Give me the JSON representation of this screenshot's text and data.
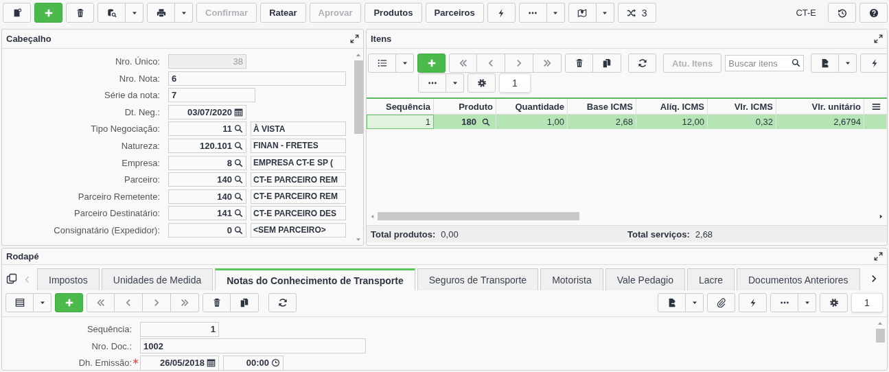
{
  "toolbar": {
    "buttons": [
      {
        "label": "Confirmar",
        "disabled": true
      },
      {
        "label": "Ratear",
        "disabled": false
      },
      {
        "label": "Aprovar",
        "disabled": true
      },
      {
        "label": "Produtos",
        "disabled": false
      },
      {
        "label": "Parceiros",
        "disabled": false
      }
    ],
    "variations_count": "3",
    "context_label": "CT-E"
  },
  "header_panel": {
    "title": "Cabeçalho",
    "fields": [
      {
        "label": "Nro. Único:",
        "kind": "number",
        "value": "38",
        "disabled": true
      },
      {
        "label": "Nro. Nota:",
        "kind": "text",
        "value": "6",
        "disabled": false
      },
      {
        "label": "Série da nota:",
        "kind": "text-short",
        "value": "7",
        "disabled": false
      },
      {
        "label": "Dt. Neg.:",
        "kind": "date",
        "value": "03/07/2020",
        "disabled": false
      },
      {
        "label": "Tipo Negociação:",
        "kind": "lookup",
        "value": "11",
        "description": "À VISTA",
        "disabled": false
      },
      {
        "label": "Natureza:",
        "kind": "lookup",
        "value": "120.101",
        "description": "FINAN - FRETES",
        "disabled": false
      },
      {
        "label": "Empresa:",
        "kind": "lookup",
        "value": "8",
        "description": "EMPRESA CT-E SP (",
        "disabled": false
      },
      {
        "label": "Parceiro:",
        "kind": "lookup",
        "value": "140",
        "description": "CT-E PARCEIRO REM",
        "disabled": false
      },
      {
        "label": "Parceiro Remetente:",
        "kind": "lookup",
        "value": "140",
        "description": "CT-E PARCEIRO REM",
        "disabled": false
      },
      {
        "label": "Parceiro Destinatário:",
        "kind": "lookup",
        "value": "141",
        "description": "CT-E PARCEIRO DES",
        "disabled": false
      },
      {
        "label": "Consignatário (Expedidor):",
        "kind": "lookup",
        "value": "0",
        "description": "<SEM PARCEIRO>",
        "disabled": false
      }
    ]
  },
  "items_panel": {
    "title": "Itens",
    "update_button": {
      "label": "Atu. Itens",
      "disabled": true
    },
    "search": {
      "placeholder": "Buscar itens"
    },
    "page": "1",
    "table": {
      "columns": [
        {
          "label": "Sequência",
          "kind": "number"
        },
        {
          "label": "Produto",
          "kind": "lookup"
        },
        {
          "label": "Quantidade",
          "kind": "number"
        },
        {
          "label": "Base ICMS",
          "kind": "number"
        },
        {
          "label": "Alíq. ICMS",
          "kind": "number"
        },
        {
          "label": "Vlr. ICMS",
          "kind": "number"
        },
        {
          "label": "Vlr. unitário",
          "kind": "number"
        }
      ],
      "rows": [
        {
          "selected": true,
          "cells": [
            "1",
            "180",
            "1,00",
            "2,68",
            "12,00",
            "0,32",
            "2,6794"
          ]
        }
      ]
    },
    "totals": [
      {
        "label": "Total produtos:",
        "value": "0,00"
      },
      {
        "label": "Total serviços:",
        "value": "2,68"
      }
    ]
  },
  "footer_panel": {
    "title": "Rodapé",
    "tabs": [
      {
        "label": "Impostos",
        "selected": false
      },
      {
        "label": "Unidades de Medida",
        "selected": false
      },
      {
        "label": "Notas do Conhecimento de Transporte",
        "selected": true
      },
      {
        "label": "Seguros de Transporte",
        "selected": false
      },
      {
        "label": "Motorista",
        "selected": false
      },
      {
        "label": "Vale Pedagio",
        "selected": false
      },
      {
        "label": "Lacre",
        "selected": false
      },
      {
        "label": "Documentos Anteriores",
        "selected": false
      }
    ],
    "page": "1",
    "fields": [
      {
        "label": "Sequência:",
        "kind": "number",
        "value": "1",
        "required": false
      },
      {
        "label": "Nro. Doc.:",
        "kind": "text",
        "value": "1002",
        "required": false
      },
      {
        "label": "Dh. Emissão:",
        "kind": "datetime",
        "value": "26/05/2018",
        "time": "00:00",
        "required": true
      }
    ]
  }
}
